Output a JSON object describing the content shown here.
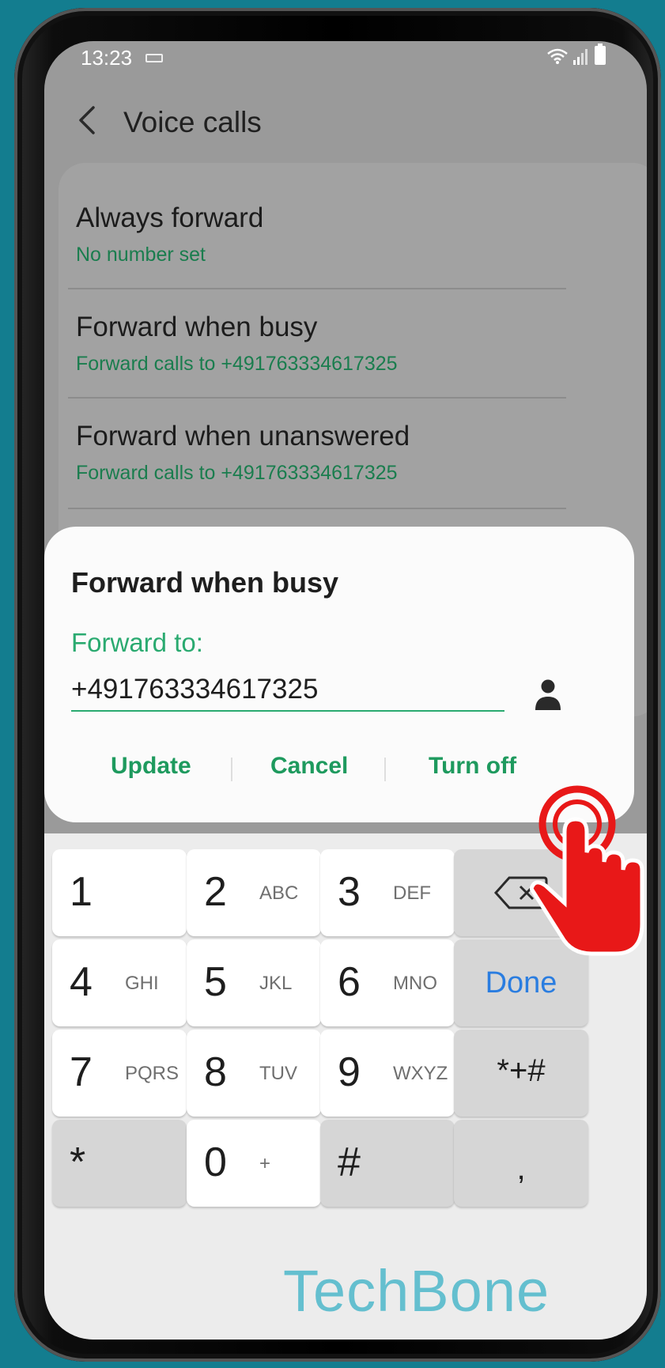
{
  "status_bar": {
    "time": "13:23"
  },
  "header": {
    "title": "Voice calls"
  },
  "settings": [
    {
      "title": "Always forward",
      "subtitle": "No number set"
    },
    {
      "title": "Forward when busy",
      "subtitle": "Forward calls to +491763334617325"
    },
    {
      "title": "Forward when unanswered",
      "subtitle": "Forward calls to +491763334617325"
    }
  ],
  "dialog": {
    "title": "Forward when busy",
    "label": "Forward to:",
    "input_value": "+491763334617325",
    "buttons": {
      "update": "Update",
      "cancel": "Cancel",
      "turn_off": "Turn off"
    }
  },
  "keypad": {
    "rows": [
      [
        {
          "digit": "1",
          "letters": ""
        },
        {
          "digit": "2",
          "letters": "ABC"
        },
        {
          "digit": "3",
          "letters": "DEF"
        },
        {
          "special": "backspace"
        }
      ],
      [
        {
          "digit": "4",
          "letters": "GHI"
        },
        {
          "digit": "5",
          "letters": "JKL"
        },
        {
          "digit": "6",
          "letters": "MNO"
        },
        {
          "special": "Done"
        }
      ],
      [
        {
          "digit": "7",
          "letters": "PQRS"
        },
        {
          "digit": "8",
          "letters": "TUV"
        },
        {
          "digit": "9",
          "letters": "WXYZ"
        },
        {
          "special": "*+#"
        }
      ],
      [
        {
          "digit": "*",
          "letters": ""
        },
        {
          "digit": "0",
          "letters": "+"
        },
        {
          "digit": "#",
          "letters": ""
        },
        {
          "special": ","
        }
      ]
    ]
  },
  "watermark": "TechBone",
  "colors": {
    "accent_green": "#1e9a5e",
    "done_blue": "#2a7de0",
    "hand_red": "#e81818",
    "background": "#137d8f"
  }
}
